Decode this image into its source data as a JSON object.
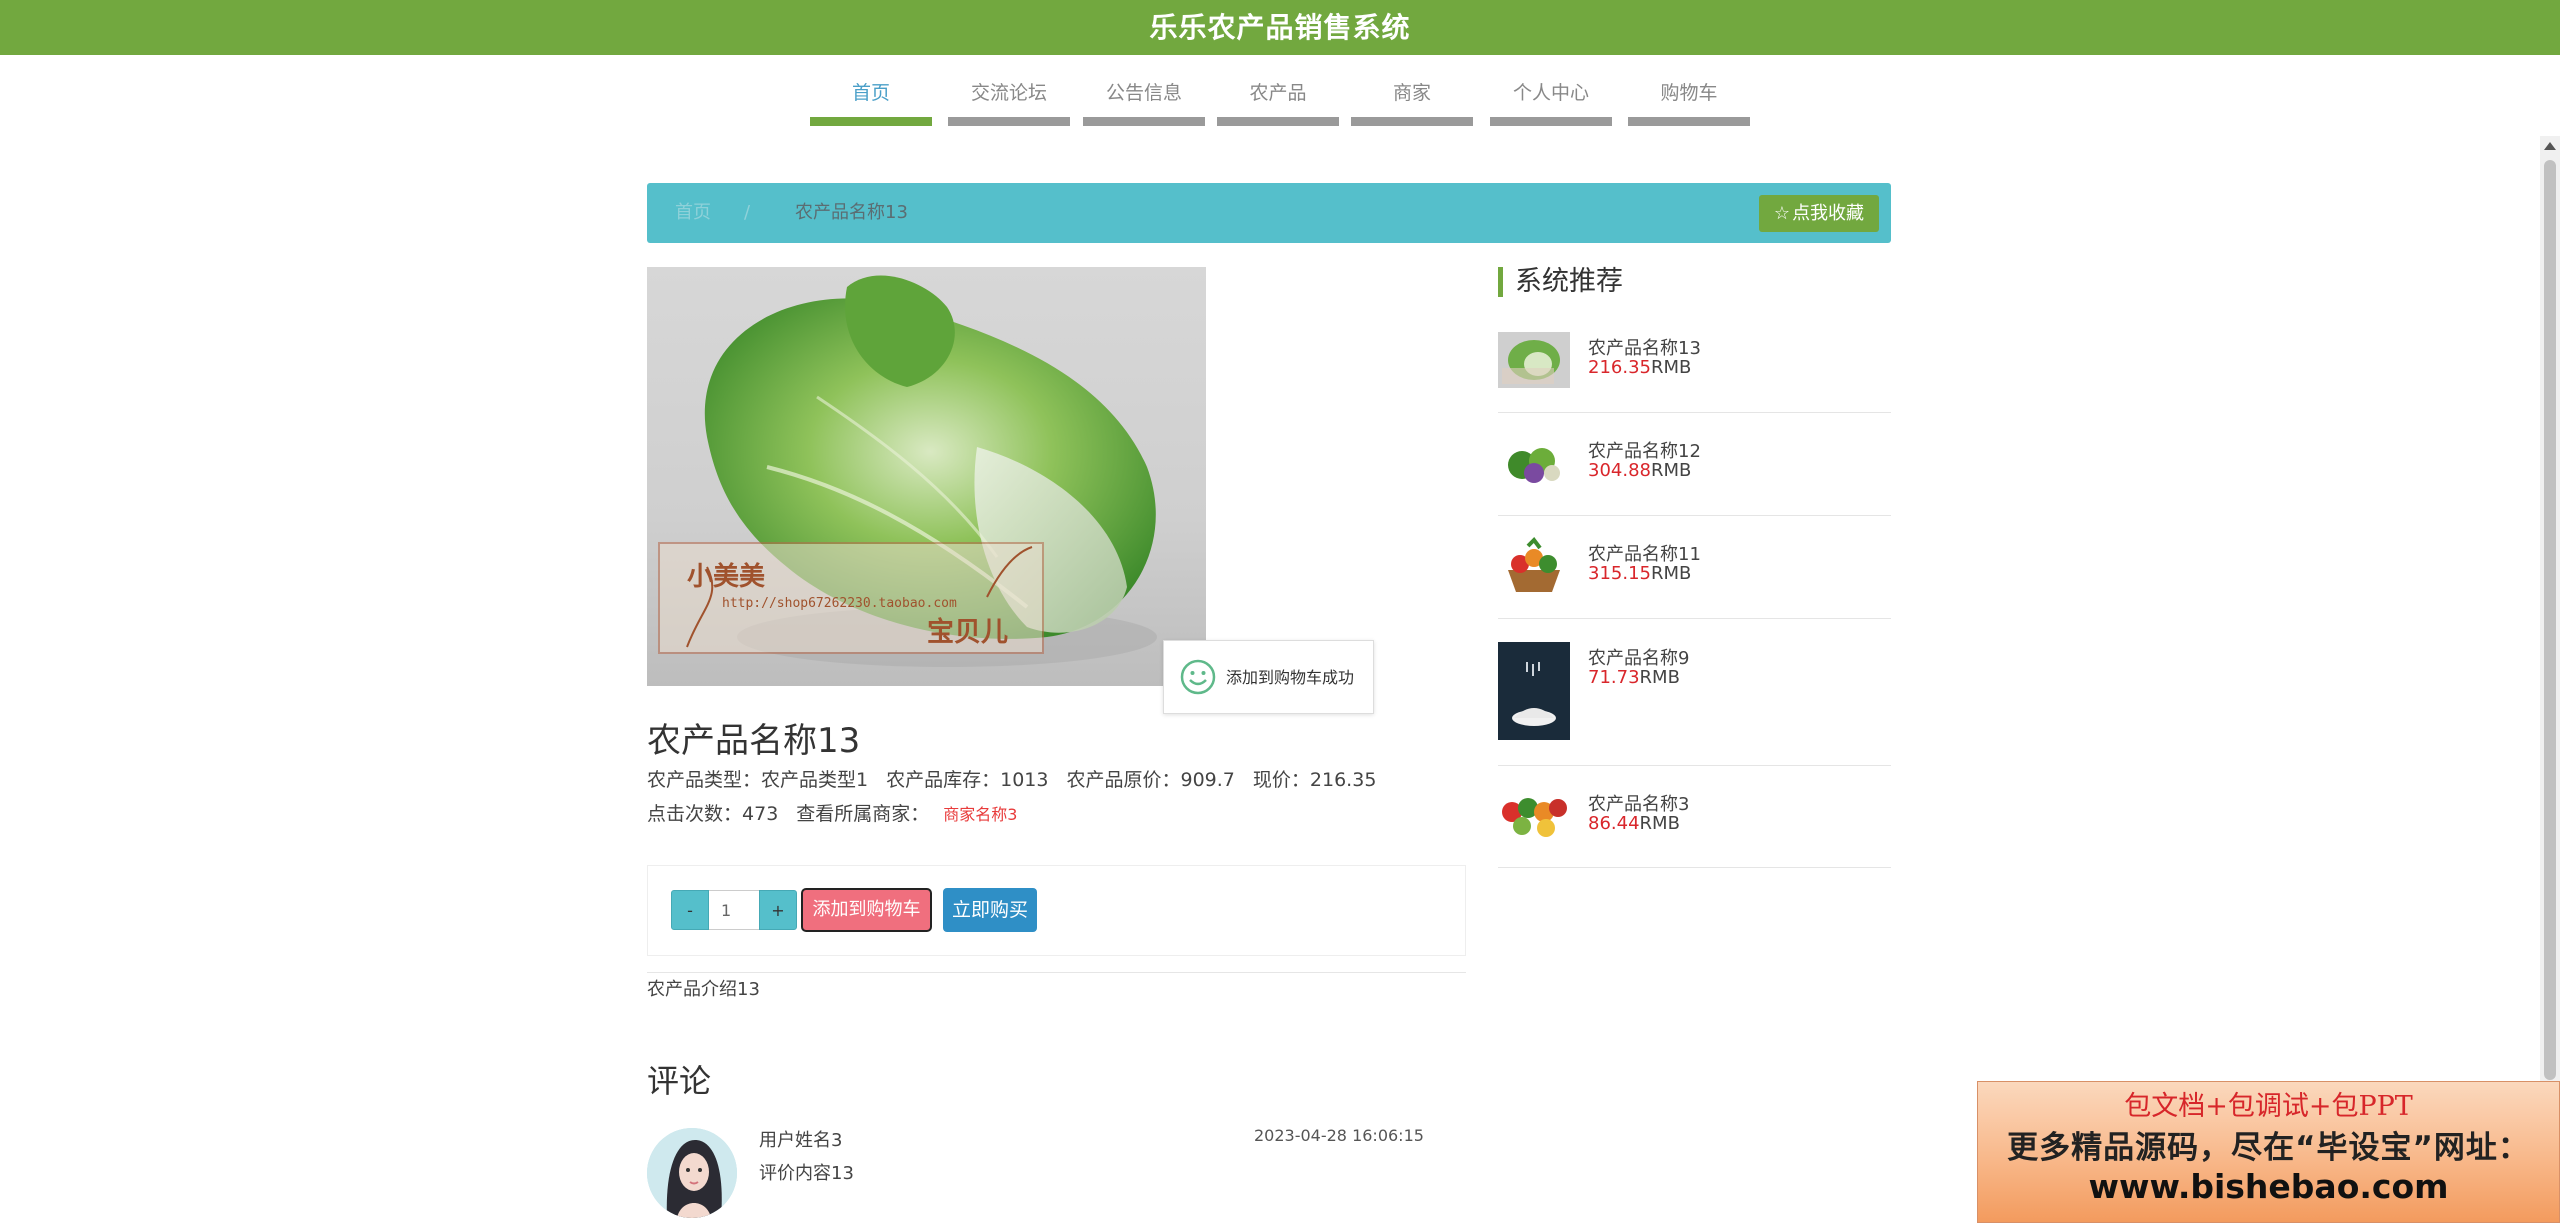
{
  "header": {
    "title": "乐乐农产品销售系统"
  },
  "nav": {
    "items": [
      {
        "label": "首页"
      },
      {
        "label": "交流论坛"
      },
      {
        "label": "公告信息"
      },
      {
        "label": "农产品"
      },
      {
        "label": "商家"
      },
      {
        "label": "个人中心"
      },
      {
        "label": "购物车"
      }
    ],
    "active": "首页"
  },
  "breadcrumb": {
    "home": "首页",
    "separator": "/",
    "current": "农产品名称13"
  },
  "favorite": {
    "icon": "star-icon",
    "label": "点我收藏"
  },
  "toast": {
    "icon": "smile-icon",
    "message": "添加到购物车成功"
  },
  "product": {
    "name": "农产品名称13",
    "type_label": "农产品类型：",
    "type_value": "农产品类型1",
    "stock_label": "农产品库存：",
    "stock_value": "1013",
    "orig_price_label": "农产品原价：",
    "orig_price_value": "909.7",
    "price_label": "现价：",
    "price_value": "216.35",
    "clicks_label": "点击次数：",
    "clicks_value": "473",
    "shop_label": "查看所属商家：",
    "shop_value": "商家名称3",
    "intro": "农产品介绍13",
    "image_text": {
      "brand": "小美美",
      "url": "http://shop67262230.taobao.com",
      "tagline": "宝贝儿"
    }
  },
  "cart": {
    "minus": "-",
    "quantity": "1",
    "plus": "+",
    "add_label": "添加到购物车",
    "buy_label": "立即购买"
  },
  "comments": {
    "title": "评论",
    "items": [
      {
        "user": "用户姓名3",
        "text": "评价内容13",
        "time": "2023-04-28 16:06:15"
      }
    ]
  },
  "sidebar": {
    "title": "系统推荐",
    "price_unit": "RMB",
    "items": [
      {
        "name": "农产品名称13",
        "price": "216.35"
      },
      {
        "name": "农产品名称12",
        "price": "304.88"
      },
      {
        "name": "农产品名称11",
        "price": "315.15"
      },
      {
        "name": "农产品名称9",
        "price": "71.73"
      },
      {
        "name": "农产品名称3",
        "price": "86.44"
      }
    ]
  },
  "ad": {
    "line1": "包文档+包调试+包PPT",
    "line2": "更多精品源码，尽在“毕设宝”网址：",
    "line3": "www.bishebao.com"
  },
  "colors": {
    "brand_green": "#72a83f",
    "breadcrumb_teal": "#55bfcb",
    "price_red": "#d9262b",
    "add_cart_pink": "#f06f7e",
    "buy_blue": "#2f8fc6"
  }
}
